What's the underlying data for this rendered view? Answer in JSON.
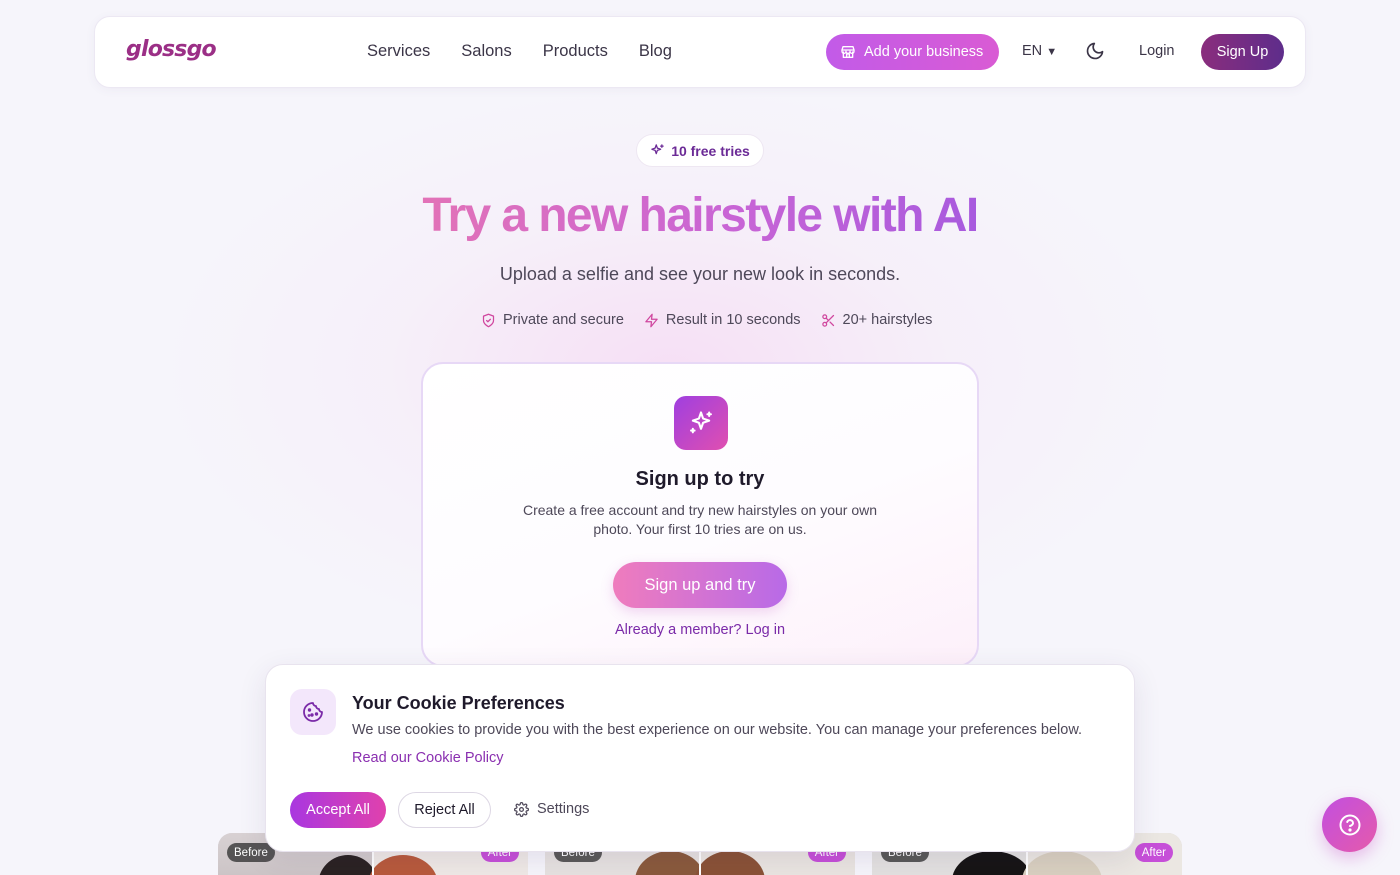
{
  "header": {
    "logo": "glossgo",
    "nav": [
      "Services",
      "Salons",
      "Products",
      "Blog"
    ],
    "add_business": "Add your business",
    "language": "EN",
    "login": "Login",
    "signup": "Sign Up"
  },
  "hero": {
    "badge": "10 free tries",
    "title": "Try a new hairstyle with AI",
    "subtitle": "Upload a selfie and see your new look in seconds.",
    "features": [
      "Private and secure",
      "Result in 10 seconds",
      "20+ hairstyles"
    ]
  },
  "card": {
    "title": "Sign up to try",
    "description": "Create a free account and try new hairstyles on your own photo. Your first 10 tries are on us.",
    "button": "Sign up and try",
    "link": "Already a member? Log in"
  },
  "examples": [
    {
      "before": "Before",
      "after": "After"
    },
    {
      "before": "Before",
      "after": "After"
    },
    {
      "before": "Before",
      "after": "After"
    }
  ],
  "cookie": {
    "title": "Your Cookie Preferences",
    "text": "We use cookies to provide you with the best experience on our website. You can manage your preferences below.",
    "policy_link": "Read our Cookie Policy",
    "accept": "Accept All",
    "reject": "Reject All",
    "settings": "Settings"
  },
  "colors": {
    "brand": "#9b2f86",
    "accent": "#c25be8",
    "signup_bg": "#6f2d87"
  }
}
